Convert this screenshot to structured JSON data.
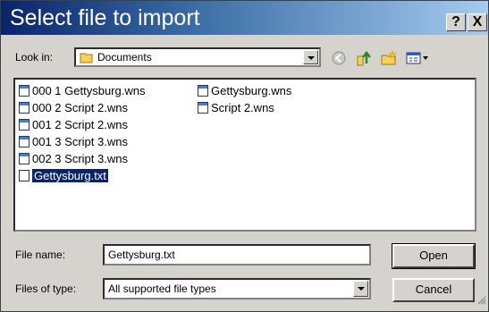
{
  "dialog": {
    "title": "Select file to import",
    "help_label": "?",
    "close_label": "X"
  },
  "lookin": {
    "label": "Look in:",
    "value": "Documents",
    "icon": "folder-icon"
  },
  "toolbar": [
    "back-icon",
    "up-folder-icon",
    "new-folder-icon",
    "view-menu-icon"
  ],
  "files": [
    {
      "name": "000 1 Gettysburg.wns",
      "icon": "wns-file-icon"
    },
    {
      "name": "000 2 Script 2.wns",
      "icon": "wns-file-icon"
    },
    {
      "name": "001 2 Script 2.wns",
      "icon": "wns-file-icon"
    },
    {
      "name": "001 3 Script 3.wns",
      "icon": "wns-file-icon"
    },
    {
      "name": "002 3 Script 3.wns",
      "icon": "wns-file-icon"
    },
    {
      "name": "Gettysburg.txt",
      "icon": "txt-file-icon",
      "selected": true
    },
    {
      "name": "Gettysburg.wns",
      "icon": "wns-file-icon"
    },
    {
      "name": "Script 2.wns",
      "icon": "wns-file-icon"
    }
  ],
  "filename": {
    "label": "File name:",
    "value": "Gettysburg.txt"
  },
  "filetype": {
    "label": "Files of type:",
    "value": "All supported file types"
  },
  "buttons": {
    "open": "Open",
    "cancel": "Cancel"
  },
  "colors": {
    "title_start": "#0a246a",
    "title_end": "#a6caf0",
    "selection": "#0a246a",
    "face": "#d6d3ce"
  }
}
